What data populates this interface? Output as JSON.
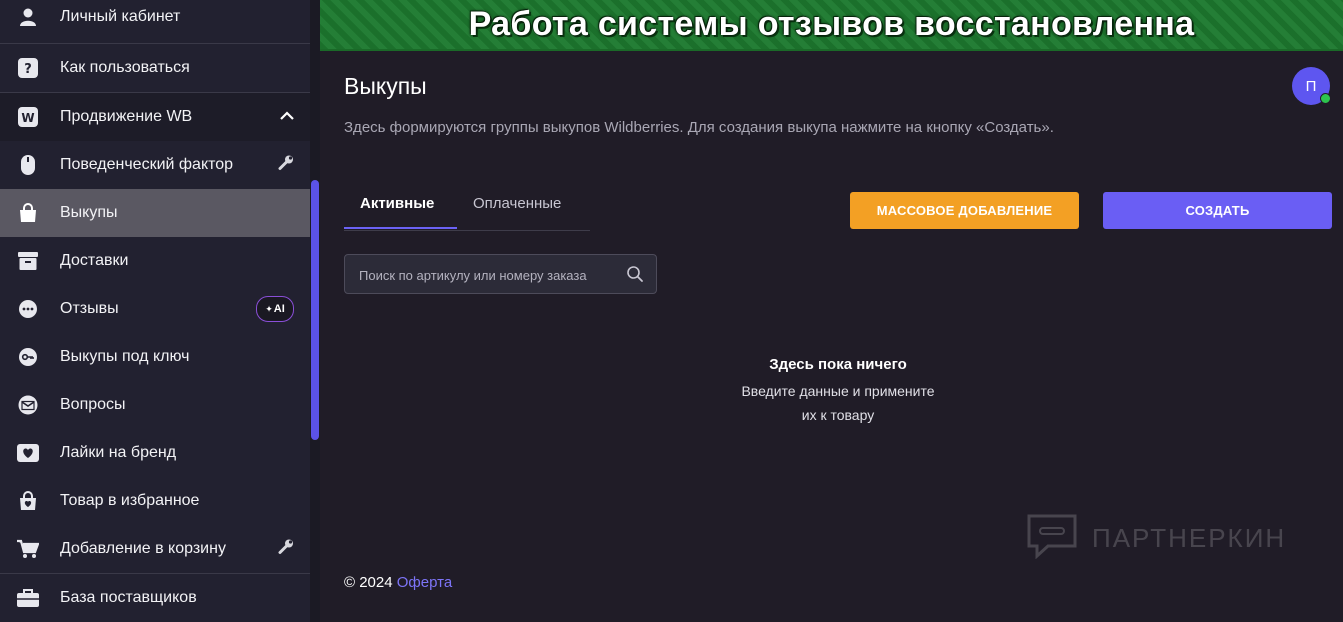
{
  "banner": {
    "text": "Работа системы отзывов восстановленна"
  },
  "sidebar": {
    "items": [
      {
        "label": "Личный кабинет",
        "icon": "user-icon"
      },
      {
        "label": "Как пользоваться",
        "icon": "help-icon"
      },
      {
        "label": "Продвижение WB",
        "icon": "wb-icon",
        "expanded": true
      },
      {
        "label": "Поведенческий фактор",
        "icon": "mouse-icon",
        "badge": "wrench-icon"
      },
      {
        "label": "Выкупы",
        "icon": "bag-icon",
        "active": true
      },
      {
        "label": "Доставки",
        "icon": "archive-icon"
      },
      {
        "label": "Отзывы",
        "icon": "chat-icon",
        "badge_text": "AI"
      },
      {
        "label": "Выкупы под ключ",
        "icon": "key-icon"
      },
      {
        "label": "Вопросы",
        "icon": "mail-icon"
      },
      {
        "label": "Лайки на бренд",
        "icon": "heart-box-icon"
      },
      {
        "label": "Товар в избранное",
        "icon": "heart-bag-icon"
      },
      {
        "label": "Добавление в корзину",
        "icon": "cart-icon",
        "badge": "wrench-icon"
      },
      {
        "label": "База поставщиков",
        "icon": "briefcase-icon"
      }
    ]
  },
  "main": {
    "title": "Выкупы",
    "description": "Здесь формируются группы выкупов Wildberries. Для создания выкупа нажмите на кнопку «Создать».",
    "avatar_initial": "П",
    "tabs": [
      {
        "label": "Активные",
        "active": true
      },
      {
        "label": "Оплаченные",
        "active": false
      }
    ],
    "buttons": {
      "mass_add": "МАССОВОЕ ДОБАВЛЕНИЕ",
      "create": "СОЗДАТЬ"
    },
    "search": {
      "placeholder": "Поиск по артикулу или номеру заказа",
      "value": ""
    },
    "empty": {
      "title": "Здесь пока ничего",
      "line1": "Введите данные и примените",
      "line2": "их к товару"
    },
    "footer": {
      "copyright": "© 2024",
      "link": "Оферта"
    },
    "watermark": "ПАРТНЕРКИН"
  },
  "colors": {
    "accent": "#6a5ef4",
    "orange": "#f3a024",
    "banner": "#1d7a2f",
    "active_item": "#5a5862"
  }
}
